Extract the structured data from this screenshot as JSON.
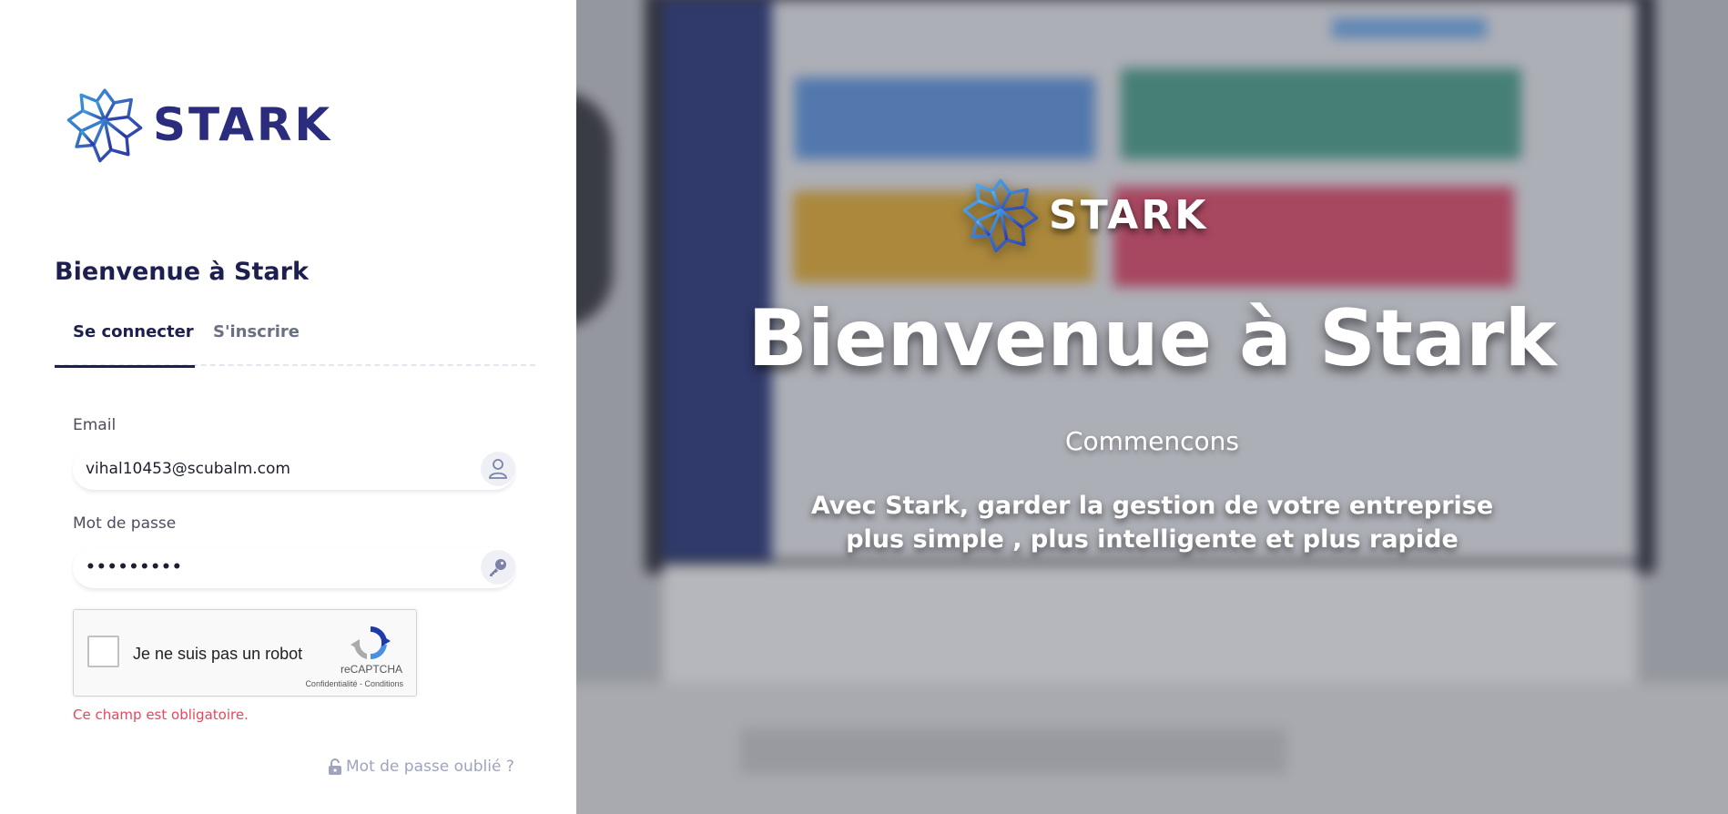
{
  "brand": {
    "name": "STARK",
    "primary_color": "#2c2c7e",
    "accent_color": "#1d1f4f"
  },
  "login": {
    "welcome": "Bienvenue à Stark",
    "tabs": [
      {
        "label": "Se connecter",
        "active": true
      },
      {
        "label": "S'inscrire",
        "active": false
      }
    ],
    "email": {
      "label": "Email",
      "value": "vihal10453@scubalm.com",
      "icon": "user-icon"
    },
    "password": {
      "label": "Mot de passe",
      "value": "•••••••••",
      "icon": "key-icon"
    },
    "recaptcha": {
      "label": "Je ne suis pas un robot",
      "brand": "reCAPTCHA",
      "links": "Confidentialité - Conditions",
      "checked": false
    },
    "error": "Ce champ est obligatoire.",
    "error_color": "#e3485b",
    "forgot": "Mot de passe oublié ?"
  },
  "hero": {
    "logo_text": "STARK",
    "title": "Bienvenue à Stark",
    "subtitle": "Commencons",
    "description_line1": "Avec Stark, garder la gestion de votre entreprise",
    "description_line2": "plus simple , plus intelligente et plus rapide"
  }
}
